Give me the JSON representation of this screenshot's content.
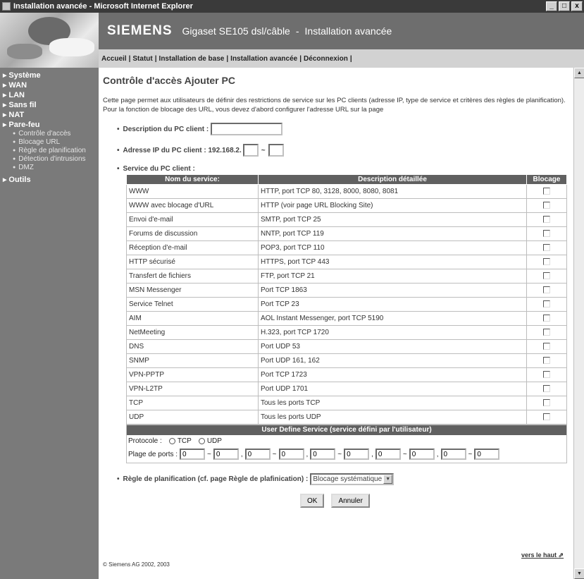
{
  "window": {
    "title": "Installation avancée - Microsoft Internet Explorer",
    "btn_min": "_",
    "btn_max": "□",
    "btn_close": "x"
  },
  "header": {
    "brand": "SIEMENS",
    "product": "Gigaset SE105 dsl/câble",
    "separator": "-",
    "page_heading": "Installation avancée",
    "nav": [
      "Accueil",
      "Statut",
      "Installation de base",
      "Installation avancée",
      "Déconnexion"
    ]
  },
  "sidebar": {
    "items": [
      {
        "label": "Système"
      },
      {
        "label": "WAN"
      },
      {
        "label": "LAN"
      },
      {
        "label": "Sans fil"
      },
      {
        "label": "NAT"
      },
      {
        "label": "Pare-feu"
      }
    ],
    "subitems": [
      "Contrôle d'accès",
      "Blocage URL",
      "Règle de planification",
      "Détection d'intrusions",
      "DMZ"
    ],
    "last_item": "Outils"
  },
  "main": {
    "title": "Contrôle d'accès Ajouter PC",
    "intro": "Cette page permet aux utilisateurs de définir des restrictions de service sur les PC clients (adresse IP, type de service et critères des règles de planification). Pour la fonction de blocage des URL, vous devez d'abord configurer l'adresse URL sur la page",
    "desc_label": "Description du PC client :",
    "ip_label": "Adresse IP du PC client : 192.168.2.",
    "ip_sep": "~",
    "service_label": "Service du PC client :",
    "table": {
      "headers": [
        "Nom du service:",
        "Description détaillée",
        "Blocage"
      ],
      "rows": [
        [
          "WWW",
          "HTTP, port TCP 80, 3128, 8000, 8080, 8081"
        ],
        [
          "WWW avec blocage d'URL",
          "HTTP (voir page URL Blocking Site)"
        ],
        [
          "Envoi d'e-mail",
          "SMTP, port TCP 25"
        ],
        [
          "Forums de discussion",
          "NNTP, port TCP 119"
        ],
        [
          "Réception d'e-mail",
          "POP3, port TCP 110"
        ],
        [
          "HTTP sécurisé",
          "HTTPS, port TCP 443"
        ],
        [
          "Transfert de fichiers",
          "FTP, port TCP 21"
        ],
        [
          "MSN Messenger",
          "Port TCP 1863"
        ],
        [
          "Service Telnet",
          "Port TCP 23"
        ],
        [
          "AIM",
          "AOL Instant Messenger, port TCP 5190"
        ],
        [
          "NetMeeting",
          "H.323, port TCP 1720"
        ],
        [
          "DNS",
          "Port UDP 53"
        ],
        [
          "SNMP",
          "Port UDP 161, 162"
        ],
        [
          "VPN-PPTP",
          "Port TCP 1723"
        ],
        [
          "VPN-L2TP",
          "Port UDP 1701"
        ],
        [
          "TCP",
          "Tous les ports TCP"
        ],
        [
          "UDP",
          "Tous les ports UDP"
        ]
      ]
    },
    "user_define": {
      "header": "User Define Service (service défini par l'utilisateur)",
      "protocol_label": "Protocole :",
      "tcp": "TCP",
      "udp": "UDP",
      "port_label": "Plage de ports :",
      "port_values": [
        "0",
        "0",
        "0",
        "0",
        "0",
        "0",
        "0",
        "0",
        "0",
        "0"
      ],
      "range_sep": "~",
      "pair_sep": ","
    },
    "schedule_label": "Règle de planification (cf. page Règle de plafinication) :",
    "schedule_value": "Blocage systématique",
    "ok": "OK",
    "cancel": "Annuler",
    "to_top": "vers le haut",
    "copyright": "© Siemens AG 2002, 2003"
  },
  "colors": {
    "sidebar_bg": "#7a7a7a",
    "header_bg": "#6e6e6e",
    "table_head": "#606060"
  }
}
